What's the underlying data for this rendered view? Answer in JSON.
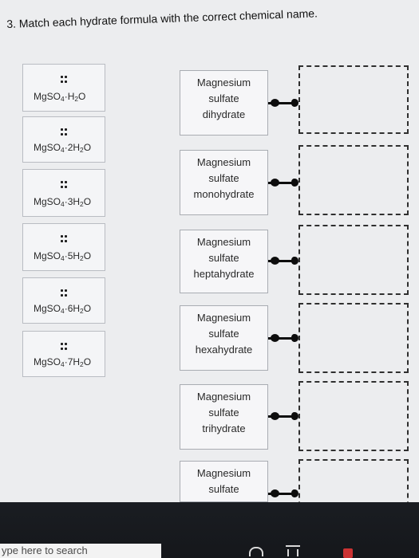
{
  "question": {
    "number": "3.",
    "text": "Match each hydrate formula with the correct chemical name."
  },
  "formulas": [
    {
      "id": "f1",
      "base": "MgSO",
      "sub1": "4",
      "dot": "·",
      "water_coeff": "",
      "h": "H",
      "sub2": "2",
      "o": "O"
    },
    {
      "id": "f2",
      "base": "MgSO",
      "sub1": "4",
      "dot": "·",
      "water_coeff": "2",
      "h": "H",
      "sub2": "2",
      "o": "O"
    },
    {
      "id": "f3",
      "base": "MgSO",
      "sub1": "4",
      "dot": "·",
      "water_coeff": "3",
      "h": "H",
      "sub2": "2",
      "o": "O"
    },
    {
      "id": "f4",
      "base": "MgSO",
      "sub1": "4",
      "dot": "·",
      "water_coeff": "5",
      "h": "H",
      "sub2": "2",
      "o": "O"
    },
    {
      "id": "f5",
      "base": "MgSO",
      "sub1": "4",
      "dot": "·",
      "water_coeff": "6",
      "h": "H",
      "sub2": "2",
      "o": "O"
    },
    {
      "id": "f6",
      "base": "MgSO",
      "sub1": "4",
      "dot": "·",
      "water_coeff": "7",
      "h": "H",
      "sub2": "2",
      "o": "O"
    }
  ],
  "names": [
    {
      "line1": "Magnesium",
      "line2": "sulfate",
      "line3": "dihydrate"
    },
    {
      "line1": "Magnesium",
      "line2": "sulfate",
      "line3": "monohydrate"
    },
    {
      "line1": "Magnesium",
      "line2": "sulfate",
      "line3": "heptahydrate"
    },
    {
      "line1": "Magnesium",
      "line2": "sulfate",
      "line3": "hexahydrate"
    },
    {
      "line1": "Magnesium",
      "line2": "sulfate",
      "line3": "trihydrate"
    },
    {
      "line1": "Magnesium",
      "line2": "sulfate",
      "line3": ""
    }
  ],
  "taskbar": {
    "search_placeholder": "ype here to search"
  },
  "icons": {
    "drag_handle": "drag-handle-icon",
    "connector": "connector-icon"
  }
}
